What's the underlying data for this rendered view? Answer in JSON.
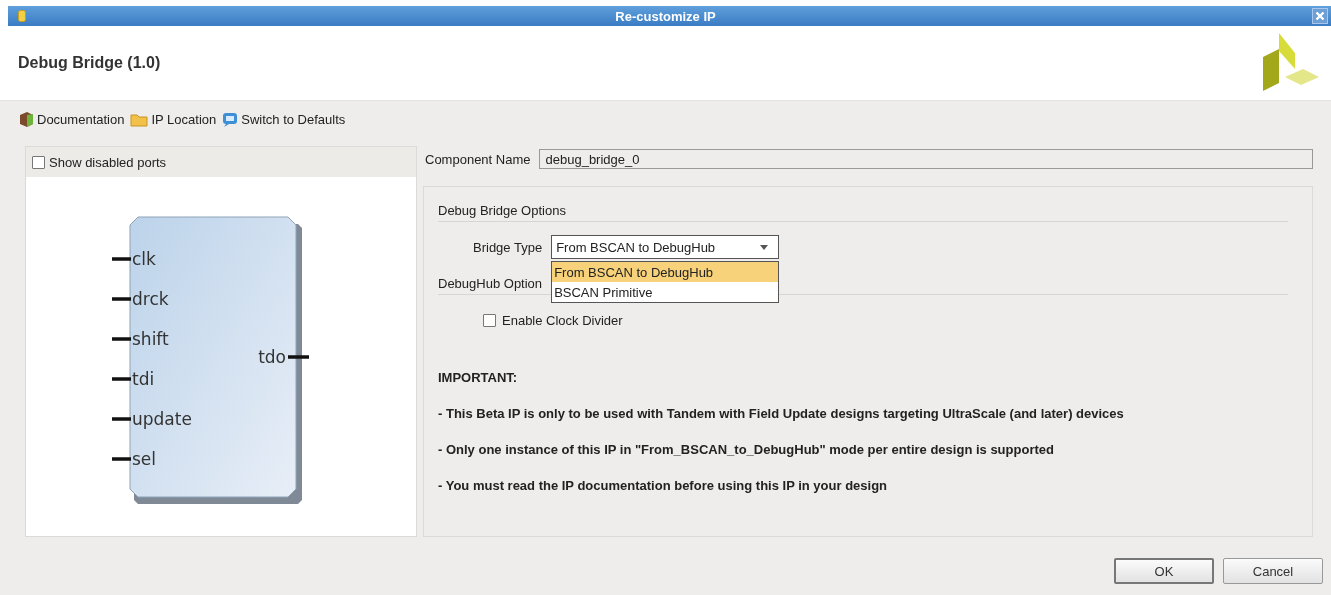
{
  "window": {
    "title": "Re-customize IP"
  },
  "header": {
    "title": "Debug Bridge (1.0)"
  },
  "toolbar": [
    {
      "label": "Documentation"
    },
    {
      "label": "IP Location"
    },
    {
      "label": "Switch to Defaults"
    }
  ],
  "symbol_panel": {
    "show_disabled_ports": {
      "label": "Show disabled ports",
      "checked": false
    },
    "inputs": [
      "clk",
      "drck",
      "shift",
      "tdi",
      "update",
      "sel"
    ],
    "outputs": [
      "tdo"
    ]
  },
  "component_name": {
    "label": "Component Name",
    "value": "debug_bridge_0"
  },
  "debug_bridge_options": {
    "title": "Debug Bridge Options",
    "bridge_type": {
      "label": "Bridge Type",
      "value": "From BSCAN to DebugHub",
      "expanded": true,
      "options": [
        {
          "label": "From BSCAN to DebugHub",
          "selected": true
        },
        {
          "label": "BSCAN Primitive",
          "selected": false
        }
      ]
    }
  },
  "debughub_options": {
    "title": "DebugHub Option",
    "enable_clock_divider": {
      "label": "Enable Clock Divider",
      "checked": false
    }
  },
  "notice": {
    "title": "IMPORTANT:",
    "lines": [
      "- This Beta IP is only to be used with Tandem with Field Update designs targeting UltraScale (and later) devices",
      "- Only one instance of this IP in \"From_BSCAN_to_DebugHub\" mode per entire design is supported",
      "- You must read the IP documentation before using this IP in your design"
    ]
  },
  "buttons": [
    "OK",
    "Cancel"
  ]
}
